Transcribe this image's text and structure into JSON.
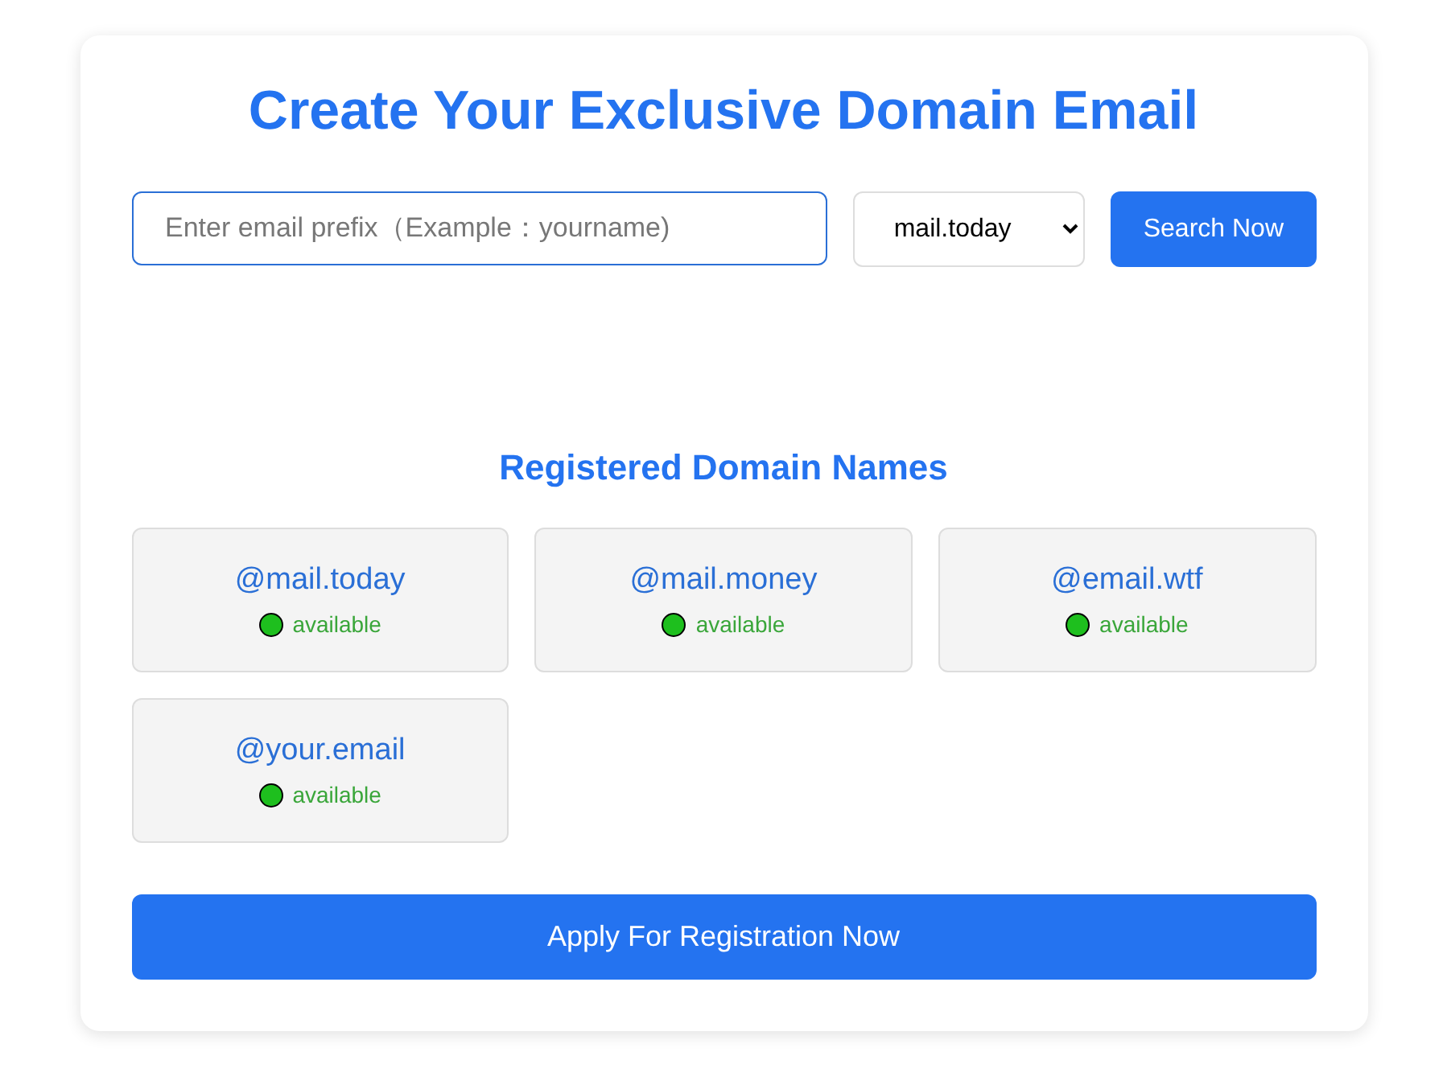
{
  "title": "Create Your Exclusive Domain Email",
  "search": {
    "placeholder": "Enter email prefix（Example：yourname)",
    "domain": "mail.today",
    "button": "Search Now"
  },
  "registered": {
    "heading": "Registered Domain Names",
    "domains": [
      {
        "name": "@mail.today",
        "status": "available"
      },
      {
        "name": "@mail.money",
        "status": "available"
      },
      {
        "name": "@email.wtf",
        "status": "available"
      },
      {
        "name": "@your.email",
        "status": "available"
      }
    ]
  },
  "apply_button": "Apply For Registration Now"
}
